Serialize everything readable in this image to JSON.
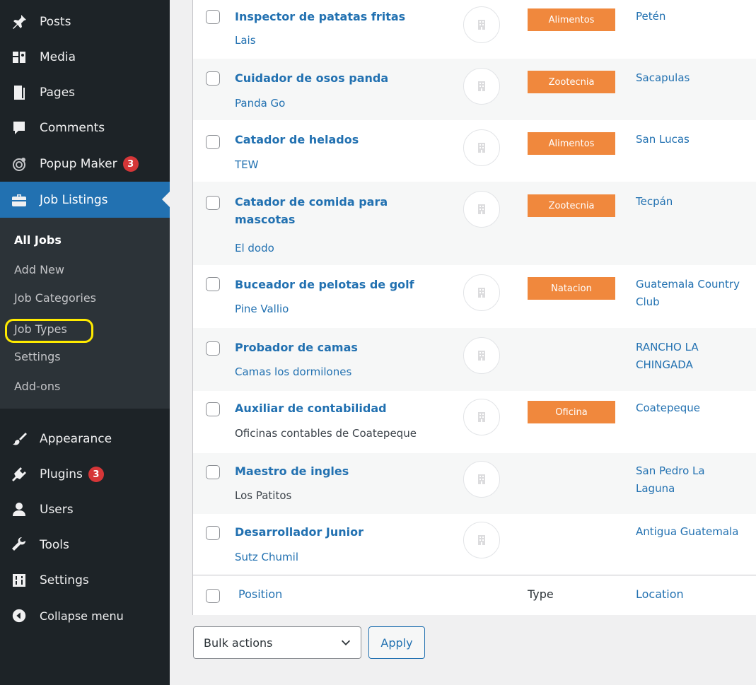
{
  "sidebar": {
    "menu": [
      {
        "label": "Posts",
        "icon": "pin-icon"
      },
      {
        "label": "Media",
        "icon": "media-icon"
      },
      {
        "label": "Pages",
        "icon": "pages-icon"
      },
      {
        "label": "Comments",
        "icon": "comment-icon"
      },
      {
        "label": "Popup Maker",
        "icon": "popup-maker-icon",
        "badge": "3"
      },
      {
        "label": "Job Listings",
        "icon": "briefcase-icon",
        "active": true
      },
      {
        "label": "Appearance",
        "icon": "paintbrush-icon"
      },
      {
        "label": "Plugins",
        "icon": "plugin-icon",
        "badge": "3"
      },
      {
        "label": "Users",
        "icon": "user-icon"
      },
      {
        "label": "Tools",
        "icon": "wrench-icon"
      },
      {
        "label": "Settings",
        "icon": "settings-icon"
      },
      {
        "label": "Collapse menu",
        "icon": "collapse-icon"
      }
    ],
    "submenu": [
      {
        "label": "All Jobs",
        "current": true
      },
      {
        "label": "Add New"
      },
      {
        "label": "Job Categories"
      },
      {
        "label": "Job Types",
        "highlighted": true
      },
      {
        "label": "Settings"
      },
      {
        "label": "Add-ons"
      }
    ]
  },
  "jobs": [
    {
      "title": "Inspector de patatas fritas",
      "company": "Lais",
      "type": "Alimentos",
      "location": "Petén"
    },
    {
      "title": "Cuidador de osos panda",
      "company": "Panda Go",
      "type": "Zootecnia",
      "location": "Sacapulas"
    },
    {
      "title": "Catador de helados",
      "company": "TEW",
      "type": "Alimentos",
      "location": "San Lucas"
    },
    {
      "title": "Catador de comida para mascotas",
      "company": "El dodo",
      "type": "Zootecnia",
      "location": "Tecpán"
    },
    {
      "title": "Buceador de pelotas de golf",
      "company": "Pine Vallio",
      "type": "Natacion",
      "location": "Guatemala Country Club"
    },
    {
      "title": "Probador de camas",
      "company": "Camas los dormilones",
      "type": "",
      "location": "RANCHO LA CHINGADA"
    },
    {
      "title": "Auxiliar de contabilidad",
      "company": "Oficinas contables de Coatepeque",
      "type": "Oficina",
      "location": "Coatepeque"
    },
    {
      "title": "Maestro de ingles",
      "company": "Los Patitos",
      "type": "",
      "location": "San Pedro La Laguna"
    },
    {
      "title": "Desarrollador Junior",
      "company": "Sutz Chumil",
      "type": "",
      "location": "Antigua Guatemala"
    }
  ],
  "table_footer": {
    "position": "Position",
    "type": "Type",
    "location": "Location"
  },
  "bulk": {
    "selected": "Bulk actions",
    "apply": "Apply"
  },
  "colors": {
    "sidebar_bg": "#1d2327",
    "active_bg": "#2271b1",
    "tag_bg": "#f0883d",
    "highlight": "#ffeb00",
    "badge": "#d63638"
  }
}
